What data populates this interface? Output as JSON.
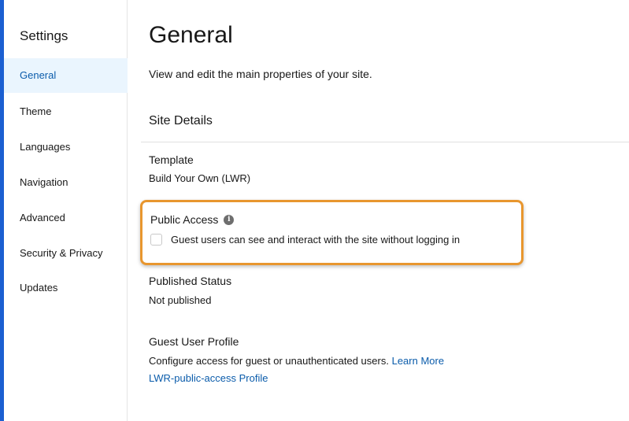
{
  "colors": {
    "accent_bar": "#1b5fd1",
    "active_nav_bg": "#eaf5fe",
    "active_nav_text": "#0b5cab",
    "highlight_border": "#e8962e",
    "link": "#0b5cab"
  },
  "sidebar": {
    "title": "Settings",
    "items": [
      {
        "label": "General",
        "active": true
      },
      {
        "label": "Theme",
        "active": false
      },
      {
        "label": "Languages",
        "active": false
      },
      {
        "label": "Navigation",
        "active": false
      },
      {
        "label": "Advanced",
        "active": false
      },
      {
        "label": "Security & Privacy",
        "active": false
      },
      {
        "label": "Updates",
        "active": false
      }
    ]
  },
  "main": {
    "title": "General",
    "description": "View and edit the main properties of your site.",
    "section_title": "Site Details",
    "template": {
      "label": "Template",
      "value": "Build Your Own (LWR)"
    },
    "public_access": {
      "label": "Public Access",
      "info_icon": "info-icon",
      "checkbox_label": "Guest users can see and interact with the site without logging in",
      "checked": false
    },
    "published_status": {
      "label": "Published Status",
      "value": "Not published"
    },
    "guest_user_profile": {
      "label": "Guest User Profile",
      "description": "Configure access for guest or unauthenticated users.",
      "learn_more": "Learn More",
      "profile_link": "LWR-public-access Profile"
    }
  }
}
